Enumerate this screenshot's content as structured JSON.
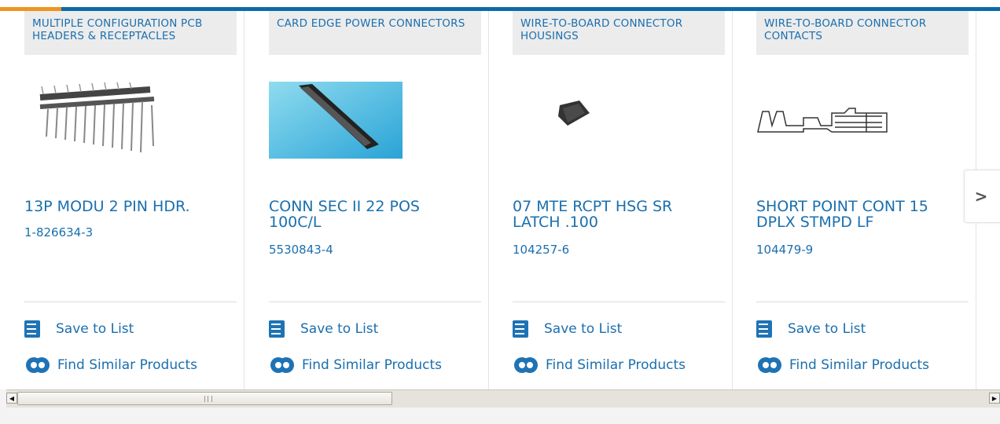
{
  "products": [
    {
      "category": "MULTIPLE CONFIGURATION PCB HEADERS & RECEPTACLES",
      "title": "13P MODU 2 PIN HDR.",
      "part_number": "1-826634-3",
      "image": "pcb-header-image",
      "save_label": "Save to List",
      "similar_label": "Find Similar Products"
    },
    {
      "category": "CARD EDGE POWER CONNECTORS",
      "title": "CONN SEC II 22 POS 100C/L",
      "part_number": "5530843-4",
      "image": "card-edge-connector-image",
      "save_label": "Save to List",
      "similar_label": "Find Similar Products"
    },
    {
      "category": "WIRE-TO-BOARD CONNECTOR HOUSINGS",
      "title": "07 MTE RCPT HSG SR LATCH .100",
      "part_number": "104257-6",
      "image": "housing-image",
      "save_label": "Save to List",
      "similar_label": "Find Similar Products"
    },
    {
      "category": "WIRE-TO-BOARD CONNECTOR CONTACTS",
      "title": "SHORT POINT CONT 15 DPLX STMPD LF",
      "part_number": "104479-9",
      "image": "contact-image",
      "save_label": "Save to List",
      "similar_label": "Find Similar Products"
    }
  ],
  "carousel": {
    "next_icon": "chevron-right-icon",
    "next_glyph": ">"
  },
  "scrollbar": {
    "left_arrow": "◀",
    "right_arrow": "▶"
  },
  "colors": {
    "accent": "#0d6aa8",
    "accent_orange": "#f0931e",
    "link": "#1a6fae"
  }
}
